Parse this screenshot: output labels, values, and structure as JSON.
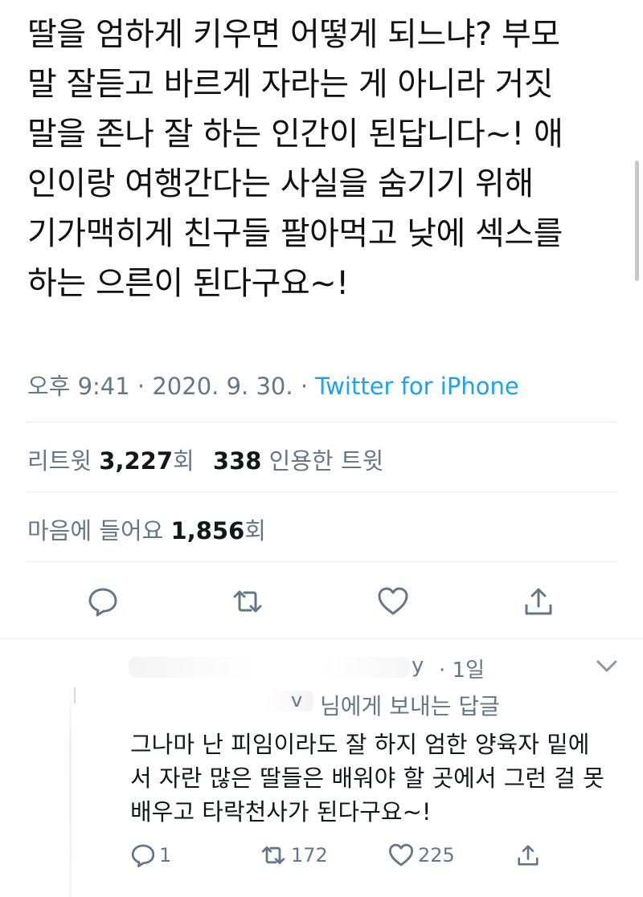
{
  "tweet": {
    "lines": [
      "딸을 엄하게 키우면 어떻게 되느냐? 부모",
      "말 잘듣고 바르게 자라는 게 아니라 거짓",
      "말을 존나 잘 하는 인간이 된답니다~! 애",
      "인이랑 여행간다는 사실을 숨기기 위해",
      "기가맥히게 친구들 팔아먹고 낮에 섹스를",
      "하는 으른이 된다구요~!"
    ],
    "time": "오후 9:41",
    "date": "2020. 9. 30.",
    "separator": "·",
    "source": "Twitter for iPhone"
  },
  "stats": {
    "retweet_label": "리트윗",
    "retweet_count": "3,227",
    "retweet_unit": "회",
    "quote_count": "338",
    "quote_label": "인용한 트윗",
    "likes_label": "마음에 들어요",
    "likes_count": "1,856",
    "likes_unit": "회"
  },
  "actions": {
    "reply_icon": "reply-icon",
    "retweet_icon": "retweet-icon",
    "like_icon": "heart-icon",
    "share_icon": "share-icon"
  },
  "reply": {
    "handle_fragment": "y",
    "time_label": "· 1일",
    "reply_to_handle_fragment": "v",
    "reply_to_label": "님에게 보내는 답글",
    "lines": [
      "그나마 난 피임이라도 잘 하지 엄한 양육자 밑에",
      "서 자란 많은 딸들은 배워야 할 곳에서 그런 걸 못",
      "배우고 타락천사가 된다구요~!"
    ],
    "reply_count": "1",
    "retweet_count": "172",
    "like_count": "225"
  },
  "colors": {
    "text": "#14171a",
    "secondary": "#657786",
    "accent": "#1da1f2",
    "divider": "#e6ecf0"
  }
}
